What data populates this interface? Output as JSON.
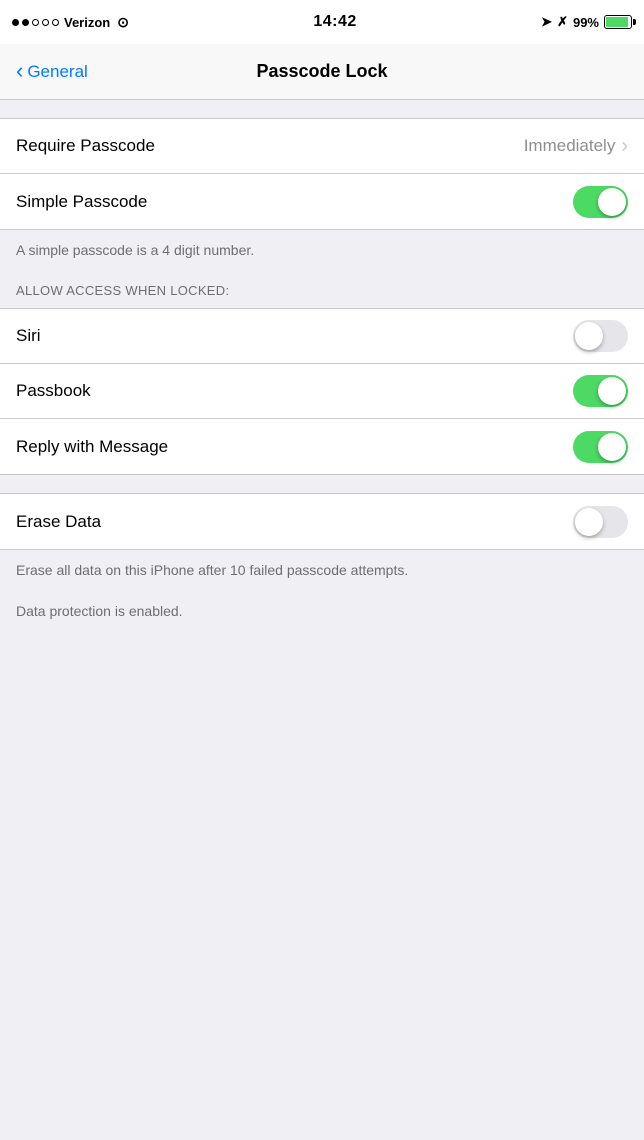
{
  "statusBar": {
    "carrier": "Verizon",
    "time": "14:42",
    "battery": "99%",
    "signal_dots": [
      true,
      true,
      false,
      false,
      false
    ]
  },
  "navBar": {
    "backLabel": "General",
    "title": "Passcode Lock"
  },
  "rows": {
    "requirePasscode": {
      "label": "Require Passcode",
      "value": "Immediately"
    },
    "simplePasscode": {
      "label": "Simple Passcode",
      "toggleOn": true
    },
    "simplePasscodeDescription": "A simple passcode is a 4 digit number.",
    "allowAccessHeader": "ALLOW ACCESS WHEN LOCKED:",
    "siri": {
      "label": "Siri",
      "toggleOn": false
    },
    "passbook": {
      "label": "Passbook",
      "toggleOn": true
    },
    "replyWithMessage": {
      "label": "Reply with Message",
      "toggleOn": true
    },
    "eraseData": {
      "label": "Erase Data",
      "toggleOn": false
    },
    "eraseDataFooter1": "Erase all data on this iPhone after 10 failed passcode attempts.",
    "eraseDataFooter2": "Data protection is enabled."
  }
}
